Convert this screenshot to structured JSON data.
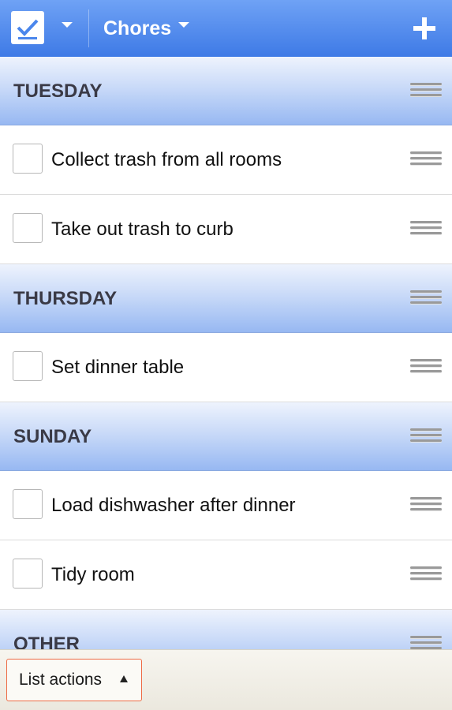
{
  "topbar": {
    "app_icon": "checkmark-icon",
    "list_title": "Chores",
    "add_icon": "plus-icon",
    "accent_color": "#4a86ec"
  },
  "sections": [
    {
      "title": "TUESDAY",
      "items": [
        "Collect trash from all rooms",
        "Take out trash to curb"
      ]
    },
    {
      "title": "THURSDAY",
      "items": [
        "Set dinner table"
      ]
    },
    {
      "title": "SUNDAY",
      "items": [
        "Load dishwasher after dinner",
        "Tidy room"
      ]
    },
    {
      "title": "OTHER",
      "items": []
    }
  ],
  "bottombar": {
    "list_actions_label": "List actions",
    "highlight_color": "#ee6b45"
  }
}
